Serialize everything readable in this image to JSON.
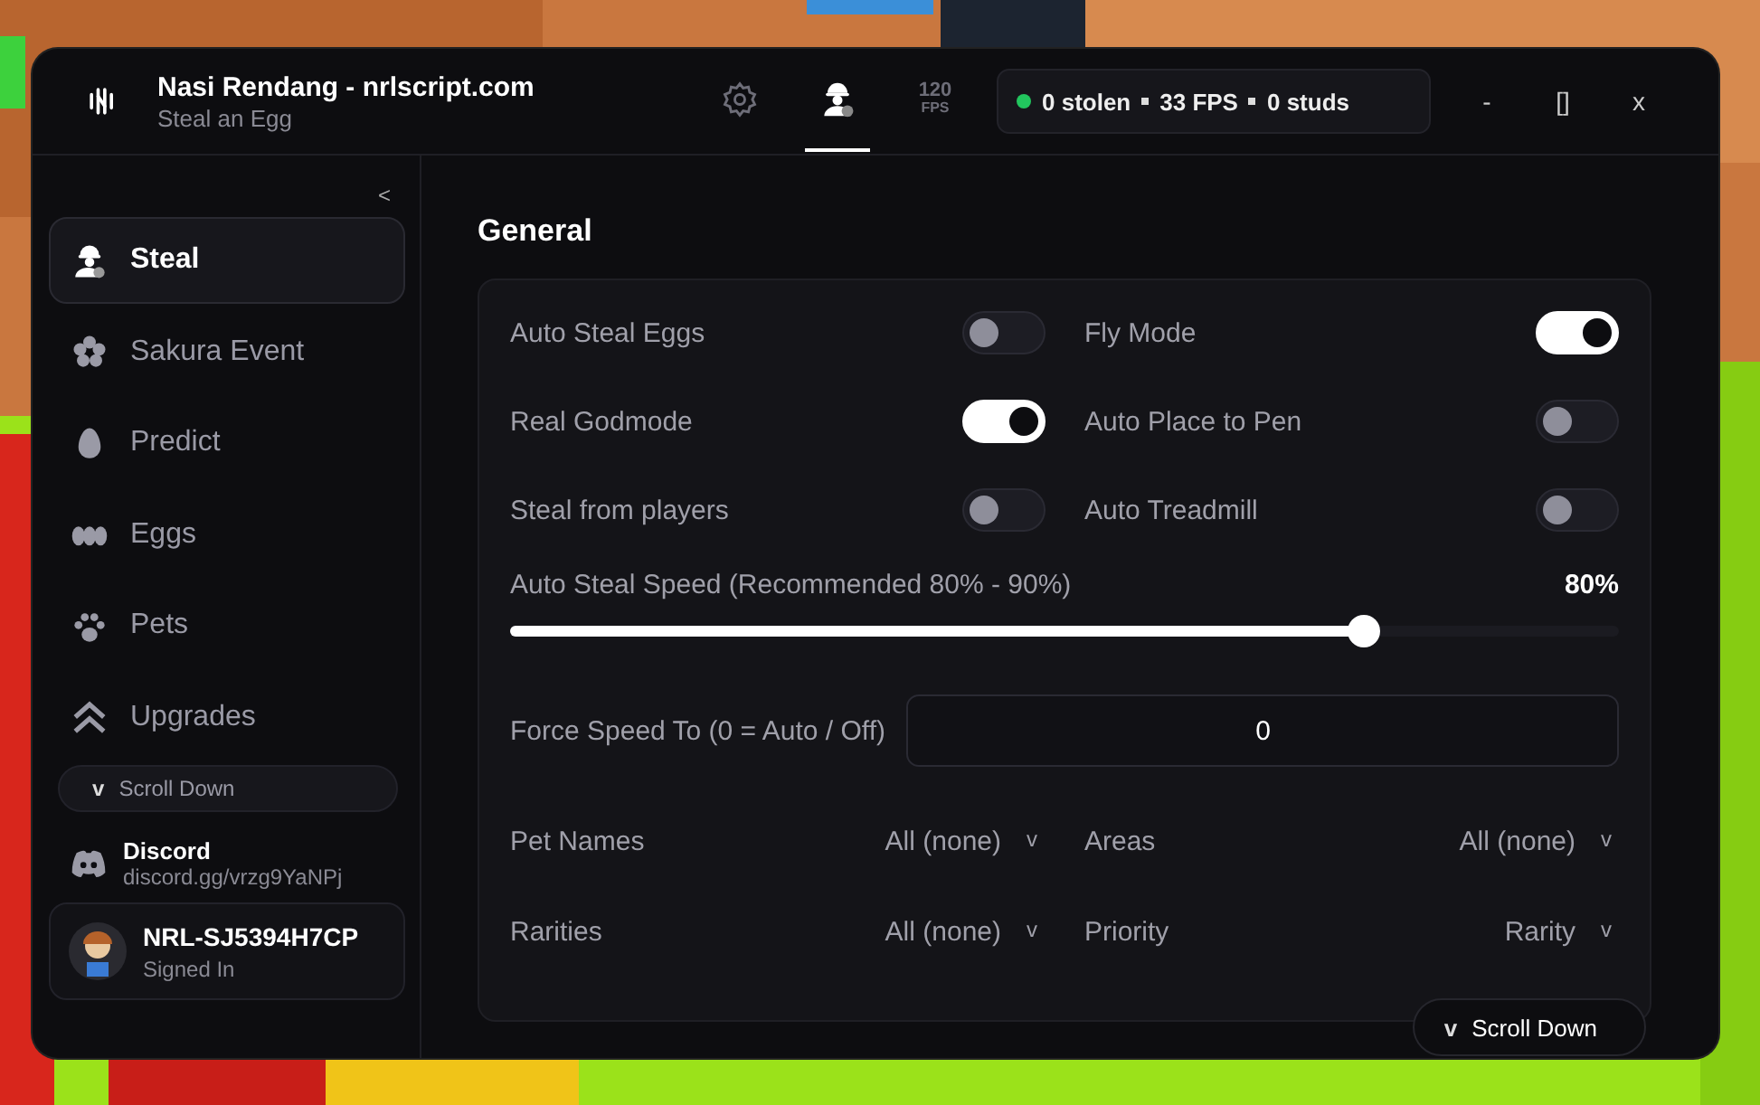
{
  "window": {
    "title": "Nasi Rendang - nrlscript.com",
    "subtitle": "Steal an Egg",
    "controls": [
      "-",
      "[]",
      "x"
    ]
  },
  "tabs": [
    {
      "kind": "gear",
      "selected": false
    },
    {
      "kind": "person",
      "selected": true
    },
    {
      "kind": "fps",
      "label": "120",
      "sublabel": "FPS",
      "selected": false
    }
  ],
  "stats": {
    "items": [
      "0 stolen",
      "33 FPS",
      "0 studs"
    ]
  },
  "sidebar": {
    "collapse": "<",
    "items": [
      {
        "label": "Steal",
        "selected": true
      },
      {
        "label": "Sakura Event",
        "selected": false
      },
      {
        "label": "Predict",
        "selected": false
      },
      {
        "label": "Eggs",
        "selected": false
      },
      {
        "label": "Pets",
        "selected": false
      },
      {
        "label": "Upgrades",
        "selected": false
      }
    ],
    "scroll": {
      "caret": "v",
      "label": "Scroll Down"
    },
    "discord": {
      "title": "Discord",
      "link": "discord.gg/vrzg9YaNPj"
    },
    "user": {
      "name": "NRL-SJ5394H7CP",
      "status": "Signed In"
    }
  },
  "section": {
    "title": "General",
    "toggles": [
      {
        "label": "Auto Steal Eggs",
        "on": false
      },
      {
        "label": "Fly Mode",
        "on": true
      },
      {
        "label": "Real Godmode",
        "on": true
      },
      {
        "label": "Auto Place to Pen",
        "on": false
      },
      {
        "label": "Steal from players",
        "on": false
      },
      {
        "label": "Auto Treadmill",
        "on": false
      }
    ],
    "slider": {
      "label": "Auto Steal Speed (Recommended 80% - 90%)",
      "reading": "80%",
      "level": 0.77
    },
    "field": {
      "label": "Force Speed To (0 = Auto / Off)",
      "value": "0"
    },
    "dropdowns": [
      {
        "label": "Pet Names",
        "value": "All (none)",
        "caret": "v"
      },
      {
        "label": "Areas",
        "value": "All (none)",
        "caret": "v"
      },
      {
        "label": "Rarities",
        "value": "All (none)",
        "caret": "v"
      },
      {
        "label": "Priority",
        "value": "Rarity",
        "caret": "v"
      }
    ]
  },
  "scroll_button": {
    "caret": "v",
    "label": "Scroll Down"
  }
}
